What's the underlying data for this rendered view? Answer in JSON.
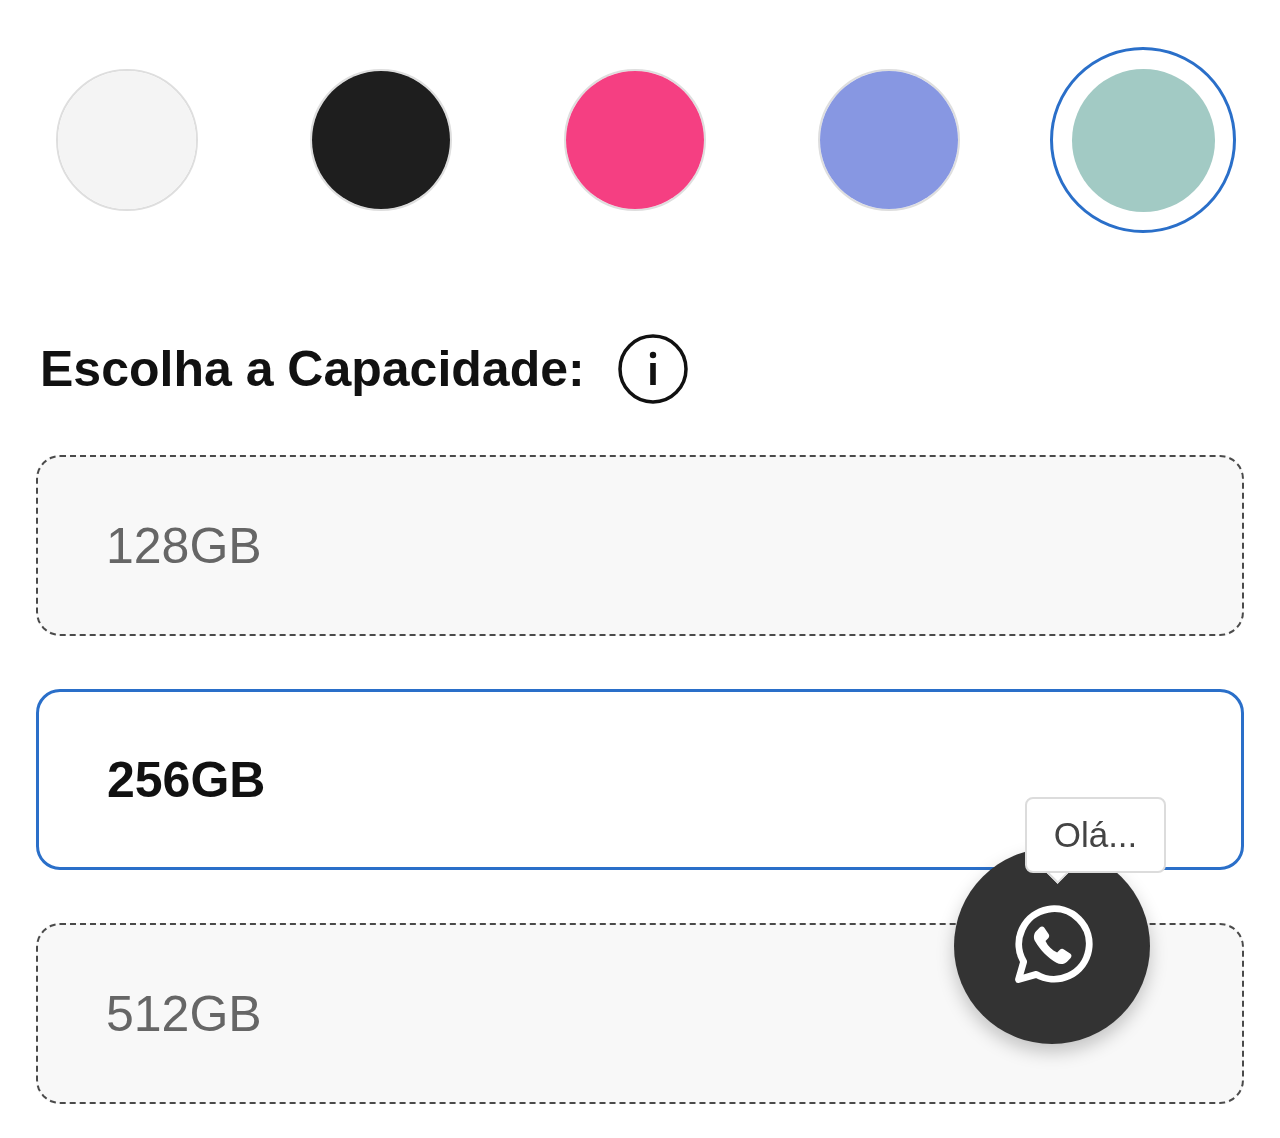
{
  "color_swatches": [
    {
      "color": "#f4f4f4",
      "selected": false
    },
    {
      "color": "#1e1e1e",
      "selected": false
    },
    {
      "color": "#f53f82",
      "selected": false
    },
    {
      "color": "#8797e2",
      "selected": false
    },
    {
      "color": "#a2cac4",
      "selected": true
    }
  ],
  "capacity": {
    "heading": "Escolha a Capacidade:",
    "options": [
      {
        "label": "128GB",
        "selected": false
      },
      {
        "label": "256GB",
        "selected": true
      },
      {
        "label": "512GB",
        "selected": false
      }
    ]
  },
  "chat": {
    "greeting": "Olá..."
  }
}
